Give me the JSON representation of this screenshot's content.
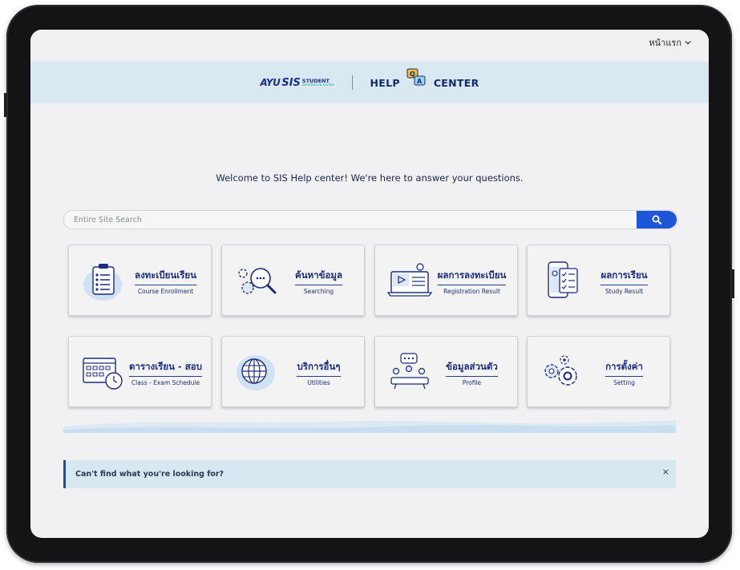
{
  "header": {
    "home_link": "หน้าแรก",
    "logo": {
      "ayu": "AYU",
      "sis": "SIS",
      "student": "STUDENT",
      "student_sub": "INFORMATION SYSTEM"
    },
    "help_left": "HELP",
    "help_right": "CENTER"
  },
  "welcome": "Welcome to SIS Help center! We're here to answer your questions.",
  "search": {
    "placeholder": "Entire Site Search"
  },
  "cards": [
    {
      "th": "ลงทะเบียนเรียน",
      "en": "Course Enrollment"
    },
    {
      "th": "ค้นหาข้อมูล",
      "en": "Searching"
    },
    {
      "th": "ผลการลงทะเบียน",
      "en": "Registration Result"
    },
    {
      "th": "ผลการเรียน",
      "en": "Study Result"
    },
    {
      "th": "ตารางเรียน - สอบ",
      "en": "Class - Exam Schedule"
    },
    {
      "th": "บริการอื่นๆ",
      "en": "Utilities"
    },
    {
      "th": "ข้อมูลส่วนตัว",
      "en": "Profile"
    },
    {
      "th": "การตั้งค่า",
      "en": "Setting"
    }
  ],
  "notice": {
    "text": "Can't find what you're looking for?",
    "close": "×"
  },
  "colors": {
    "accent": "#1d57d8",
    "navy": "#1b2a7c",
    "banner": "#d9e8f1"
  }
}
